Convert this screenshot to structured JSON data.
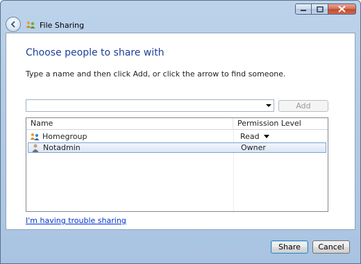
{
  "window": {
    "title": "File Sharing"
  },
  "dialog": {
    "heading": "Choose people to share with",
    "instructions": "Type a name and then click Add, or click the arrow to find someone.",
    "name_input": {
      "value": "",
      "placeholder": ""
    },
    "add_label": "Add"
  },
  "list": {
    "columns": {
      "name": "Name",
      "permission": "Permission Level"
    },
    "rows": [
      {
        "name": "Homegroup",
        "permission": "Read",
        "icon": "homegroup-icon"
      },
      {
        "name": "Notadmin",
        "permission": "Owner",
        "icon": "user-icon",
        "selected": true
      }
    ]
  },
  "trouble_link": "I'm having trouble sharing",
  "footer": {
    "share_label": "Share",
    "cancel_label": "Cancel"
  },
  "colors": {
    "heading": "#1f3f9a",
    "link": "#0033cc",
    "selection_border": "#7da2ce"
  }
}
